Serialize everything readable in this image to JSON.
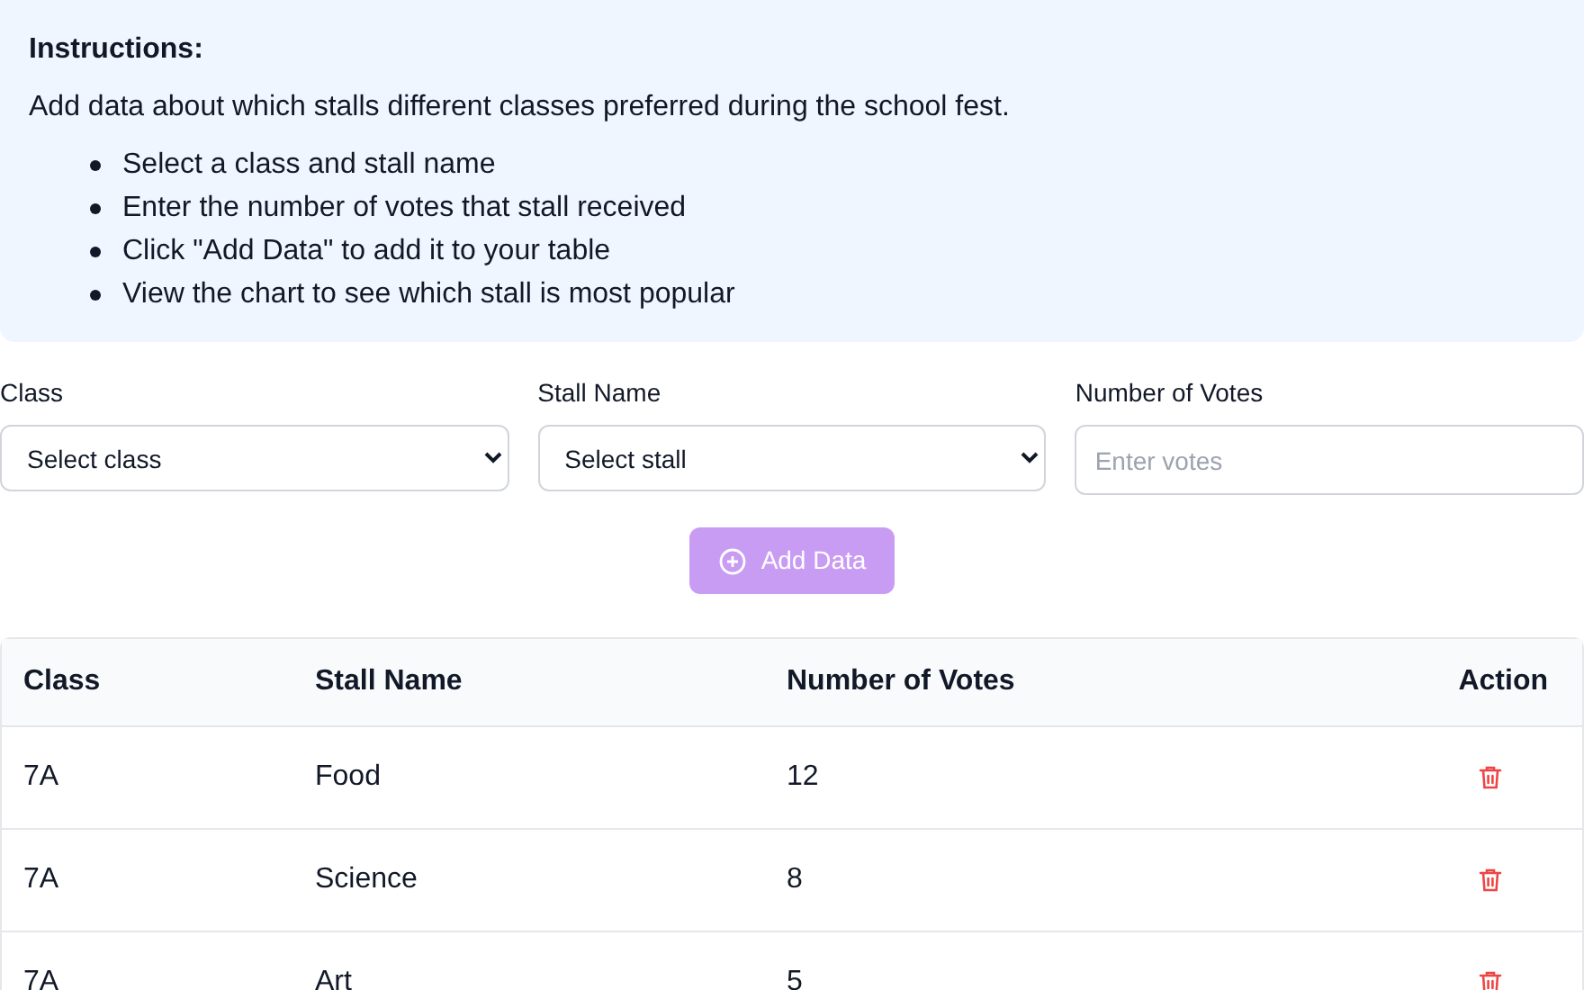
{
  "instructions": {
    "title": "Instructions:",
    "intro": "Add data about which stalls different classes preferred during the school fest.",
    "steps": [
      "Select a class and stall name",
      "Enter the number of votes that stall received",
      "Click \"Add Data\" to add it to your table",
      "View the chart to see which stall is most popular"
    ]
  },
  "form": {
    "fields": [
      {
        "kind": "select",
        "label": "Class",
        "value": "Select class"
      },
      {
        "kind": "select",
        "label": "Stall Name",
        "value": "Select stall"
      },
      {
        "kind": "input",
        "label": "Number of Votes",
        "placeholder": "Enter votes"
      }
    ],
    "add_button": {
      "label": "Add Data",
      "disabled": true
    }
  },
  "table": {
    "columns": [
      "Class",
      "Stall Name",
      "Number of Votes",
      "Action"
    ],
    "rows": [
      {
        "class": "7A",
        "stall": "Food",
        "votes": "12"
      },
      {
        "class": "7A",
        "stall": "Science",
        "votes": "8"
      },
      {
        "class": "7A",
        "stall": "Art",
        "votes": "5"
      }
    ]
  }
}
